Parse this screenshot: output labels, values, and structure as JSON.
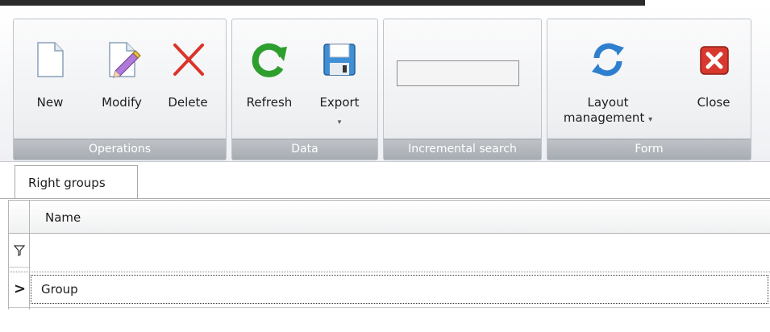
{
  "ribbon": {
    "groups": [
      {
        "caption": "Operations",
        "buttons": [
          {
            "label": "New",
            "icon": "new-document-icon"
          },
          {
            "label": "Modify",
            "icon": "edit-document-icon"
          },
          {
            "label": "Delete",
            "icon": "delete-x-icon"
          }
        ]
      },
      {
        "caption": "Data",
        "buttons": [
          {
            "label": "Refresh",
            "icon": "refresh-icon"
          },
          {
            "label": "Export",
            "icon": "save-disk-icon"
          }
        ]
      },
      {
        "caption": "Incremental search",
        "search_value": ""
      },
      {
        "caption": "Form",
        "buttons": [
          {
            "label": "Layout management",
            "label_line1": "Layout",
            "label_line2": "management",
            "icon": "sync-arrows-icon"
          },
          {
            "label": "Close",
            "icon": "close-red-icon"
          }
        ]
      }
    ],
    "export_dropdown_arrow": "▾",
    "layout_dropdown_arrow": "▾"
  },
  "tabs": [
    {
      "label": "Right groups",
      "active": true
    }
  ],
  "grid": {
    "columns": [
      "Name"
    ],
    "filter_value": "",
    "rows": [
      {
        "name": "Group",
        "focused": true
      }
    ],
    "row_indicator": ">"
  },
  "colors": {
    "accent_green": "#2e9e2e",
    "delete_red": "#d9342b",
    "close_red": "#d8392e",
    "caption_gray": "#a7acb2"
  }
}
